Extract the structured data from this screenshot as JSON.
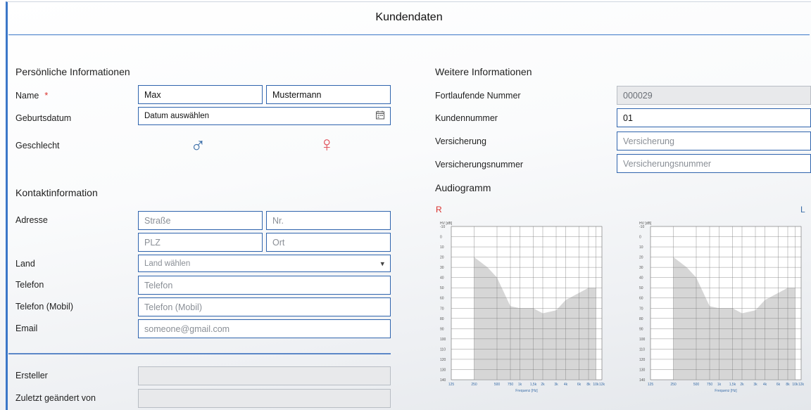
{
  "header": {
    "title": "Kundendaten"
  },
  "personal": {
    "title": "Persönliche Informationen",
    "name_label": "Name",
    "required_mark": "*",
    "first_name": "Max",
    "last_name": "Mustermann",
    "birthdate_label": "Geburtsdatum",
    "birthdate_placeholder": "Datum auswählen",
    "gender_label": "Geschlecht",
    "male_symbol": "♂",
    "female_symbol": "♀"
  },
  "contact": {
    "title": "Kontaktinformation",
    "address_label": "Adresse",
    "street_placeholder": "Straße",
    "number_placeholder": "Nr.",
    "zip_placeholder": "PLZ",
    "city_placeholder": "Ort",
    "country_label": "Land",
    "country_placeholder": "Land wählen",
    "phone_label": "Telefon",
    "phone_placeholder": "Telefon",
    "mobile_label": "Telefon (Mobil)",
    "mobile_placeholder": "Telefon (Mobil)",
    "email_label": "Email",
    "email_placeholder": "someone@gmail.com"
  },
  "meta": {
    "creator_label": "Ersteller",
    "modified_label": "Zuletzt geändert von"
  },
  "further": {
    "title": "Weitere Informationen",
    "serial_label": "Fortlaufende Nummer",
    "serial_value": "000029",
    "customer_no_label": "Kundennummer",
    "customer_no_value": "01",
    "insurance_label": "Versicherung",
    "insurance_placeholder": "Versicherung",
    "insurance_no_label": "Versicherungsnummer",
    "insurance_no_placeholder": "Versicherungsnummer"
  },
  "audiogram": {
    "title": "Audiogramm",
    "right_label": "R",
    "left_label": "L",
    "y_axis_label": "HV [dB]",
    "x_axis_label": "Frequenz [Hz]",
    "y_ticks": [
      "-10",
      "0",
      "10",
      "20",
      "30",
      "40",
      "50",
      "60",
      "70",
      "80",
      "90",
      "100",
      "110",
      "120",
      "130",
      "140"
    ],
    "x_ticks": [
      "125",
      "250",
      "500",
      "750",
      "1k",
      "1,5k",
      "2k",
      "3k",
      "4k",
      "6k",
      "8k",
      "10k",
      "12k"
    ],
    "colors": {
      "right": "#d9302c",
      "left": "#3b6ea8",
      "fill": "#d6d6d6"
    },
    "charts": [
      {
        "ear": "R",
        "curve": [
          [
            250,
            20
          ],
          [
            375,
            30
          ],
          [
            500,
            40
          ],
          [
            750,
            68
          ],
          [
            1000,
            70
          ],
          [
            1500,
            70
          ],
          [
            2000,
            75
          ],
          [
            3000,
            72
          ],
          [
            4000,
            62
          ],
          [
            6000,
            55
          ],
          [
            8000,
            50
          ],
          [
            10000,
            50
          ]
        ]
      },
      {
        "ear": "L",
        "curve": [
          [
            250,
            20
          ],
          [
            375,
            30
          ],
          [
            500,
            40
          ],
          [
            750,
            68
          ],
          [
            1000,
            70
          ],
          [
            1500,
            70
          ],
          [
            2000,
            75
          ],
          [
            3000,
            72
          ],
          [
            4000,
            62
          ],
          [
            6000,
            55
          ],
          [
            8000,
            50
          ],
          [
            10000,
            50
          ]
        ]
      }
    ]
  },
  "chart_data": {
    "type": "area",
    "title": "Audiogramm",
    "xlabel": "Frequenz [Hz]",
    "ylabel": "HV [dB]",
    "ylim": [
      -10,
      140
    ],
    "x": [
      250,
      375,
      500,
      750,
      1000,
      1500,
      2000,
      3000,
      4000,
      6000,
      8000,
      10000
    ],
    "series": [
      {
        "name": "R",
        "values": [
          20,
          30,
          40,
          68,
          70,
          70,
          75,
          72,
          62,
          55,
          50,
          50
        ]
      },
      {
        "name": "L",
        "values": [
          20,
          30,
          40,
          68,
          70,
          70,
          75,
          72,
          62,
          55,
          50,
          50
        ]
      }
    ]
  }
}
